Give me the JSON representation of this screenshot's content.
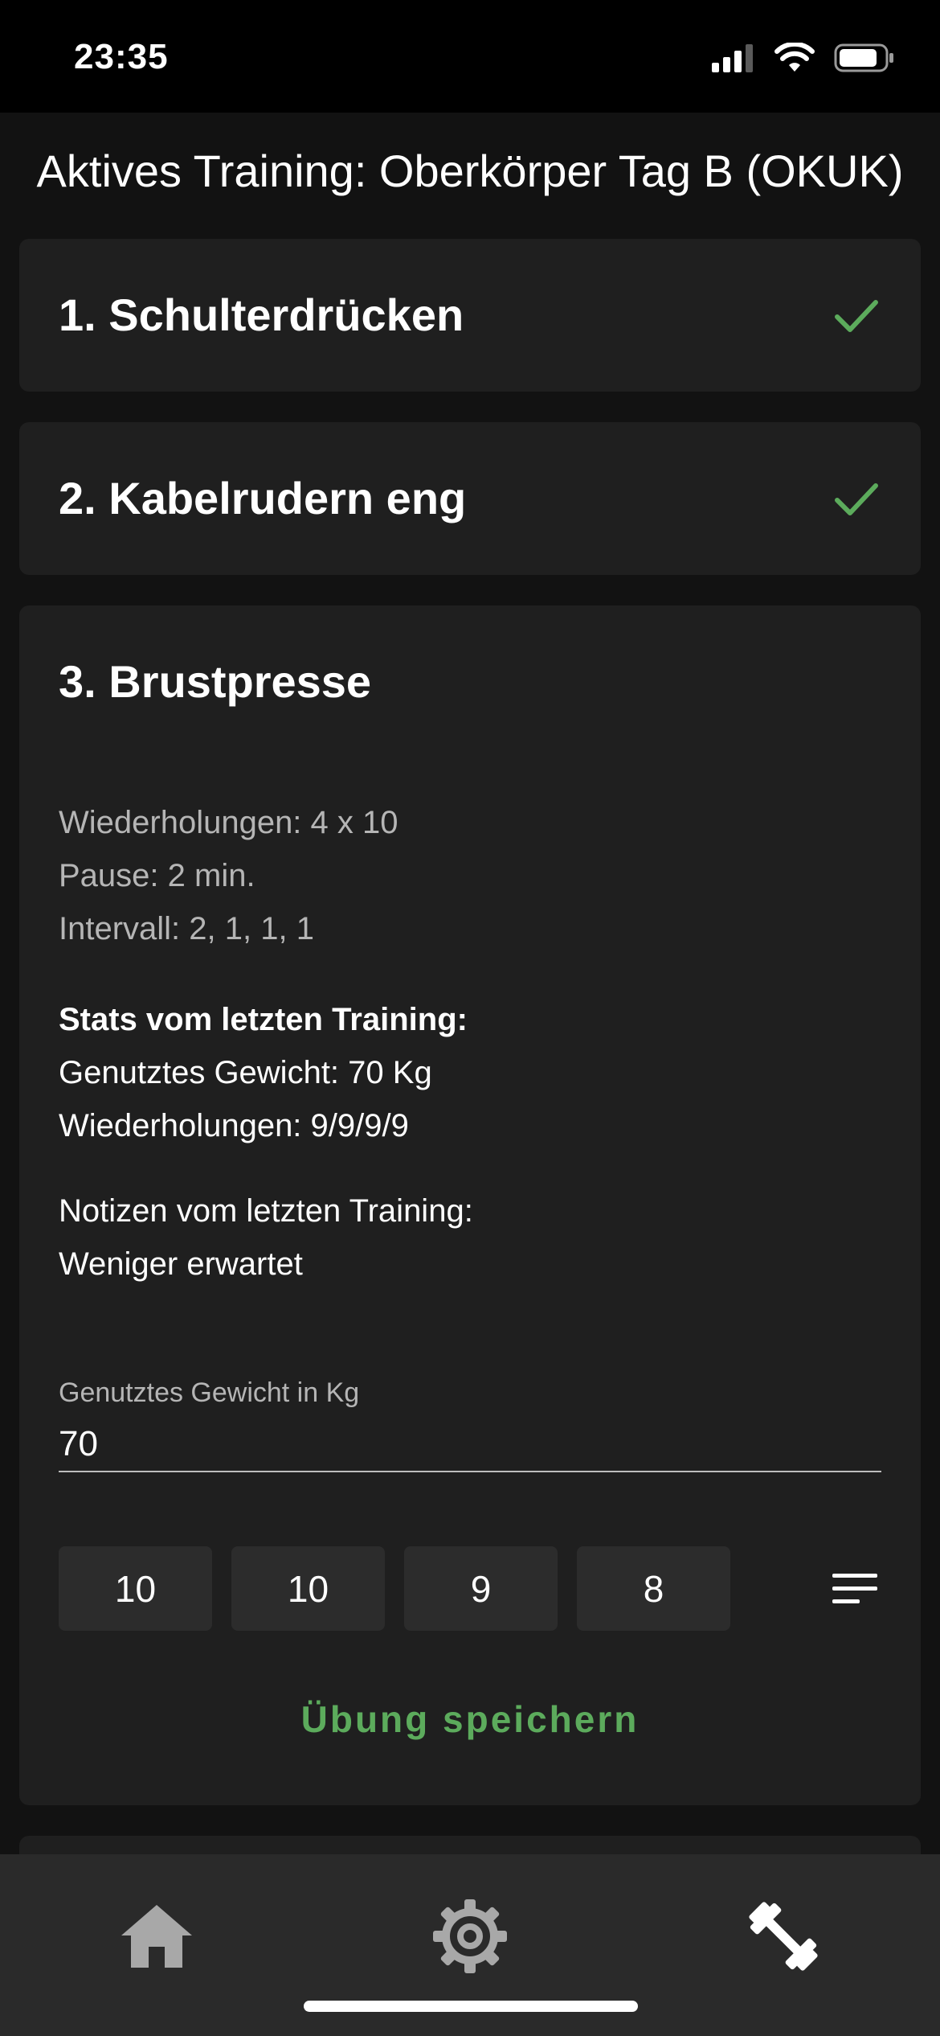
{
  "status_bar": {
    "time": "23:35"
  },
  "header": {
    "title": "Aktives Training: Oberkörper Tag B (OKUK)"
  },
  "exercises": [
    {
      "title": "1. Schulterdrücken",
      "completed": true
    },
    {
      "title": "2. Kabelrudern eng",
      "completed": true
    },
    {
      "title": "3. Brustpresse",
      "completed": false,
      "repetitions": "Wiederholungen: 4 x 10",
      "pause": "Pause: 2 min.",
      "interval": "Intervall: 2, 1, 1, 1",
      "last_stats_heading": "Stats vom letzten Training:",
      "last_weight": "Genutztes Gewicht: 70 Kg",
      "last_reps": "Wiederholungen: 9/9/9/9",
      "notes_heading": "Notizen vom letzten Training:",
      "notes_text": "Weniger erwartet",
      "weight_label": "Genutztes Gewicht in Kg",
      "weight_value": "70",
      "set_reps": [
        "10",
        "10",
        "9",
        "8"
      ],
      "save_label": "Übung speichern"
    }
  ],
  "bottom_nav": {
    "items": [
      {
        "icon": "home-icon"
      },
      {
        "icon": "gear-icon"
      },
      {
        "icon": "dumbbell-icon",
        "active": true
      }
    ]
  },
  "colors": {
    "accent_green": "#5cab5c",
    "background": "#121212",
    "card": "#1f1f1f"
  }
}
